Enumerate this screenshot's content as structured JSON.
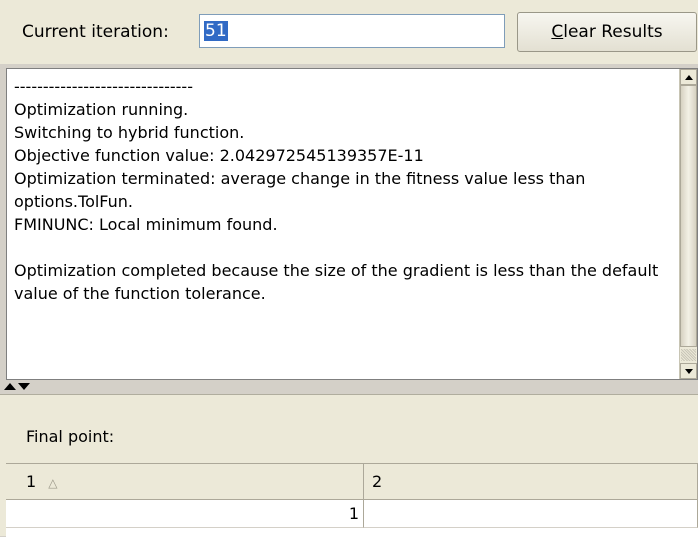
{
  "top": {
    "iteration_label": "Current iteration:",
    "iteration_value": "51",
    "clear_button": {
      "accel": "C",
      "rest": "lear Results"
    }
  },
  "output": {
    "text": "-------------------------------\nOptimization running.\nSwitching to hybrid function.\nObjective function value: 2.042972545139357E-11\nOptimization terminated: average change in the fitness value less than options.TolFun.\nFMINUNC: Local minimum found.\n\nOptimization completed because the size of the gradient is less than the default value of the function tolerance."
  },
  "results": {
    "final_point_label": "Final point:",
    "columns": [
      "1",
      "2"
    ],
    "rows": [
      [
        "1",
        ""
      ]
    ]
  },
  "colors": {
    "panel": "#ece9d8",
    "selection": "#316ac5",
    "field_border": "#7f9db9"
  }
}
